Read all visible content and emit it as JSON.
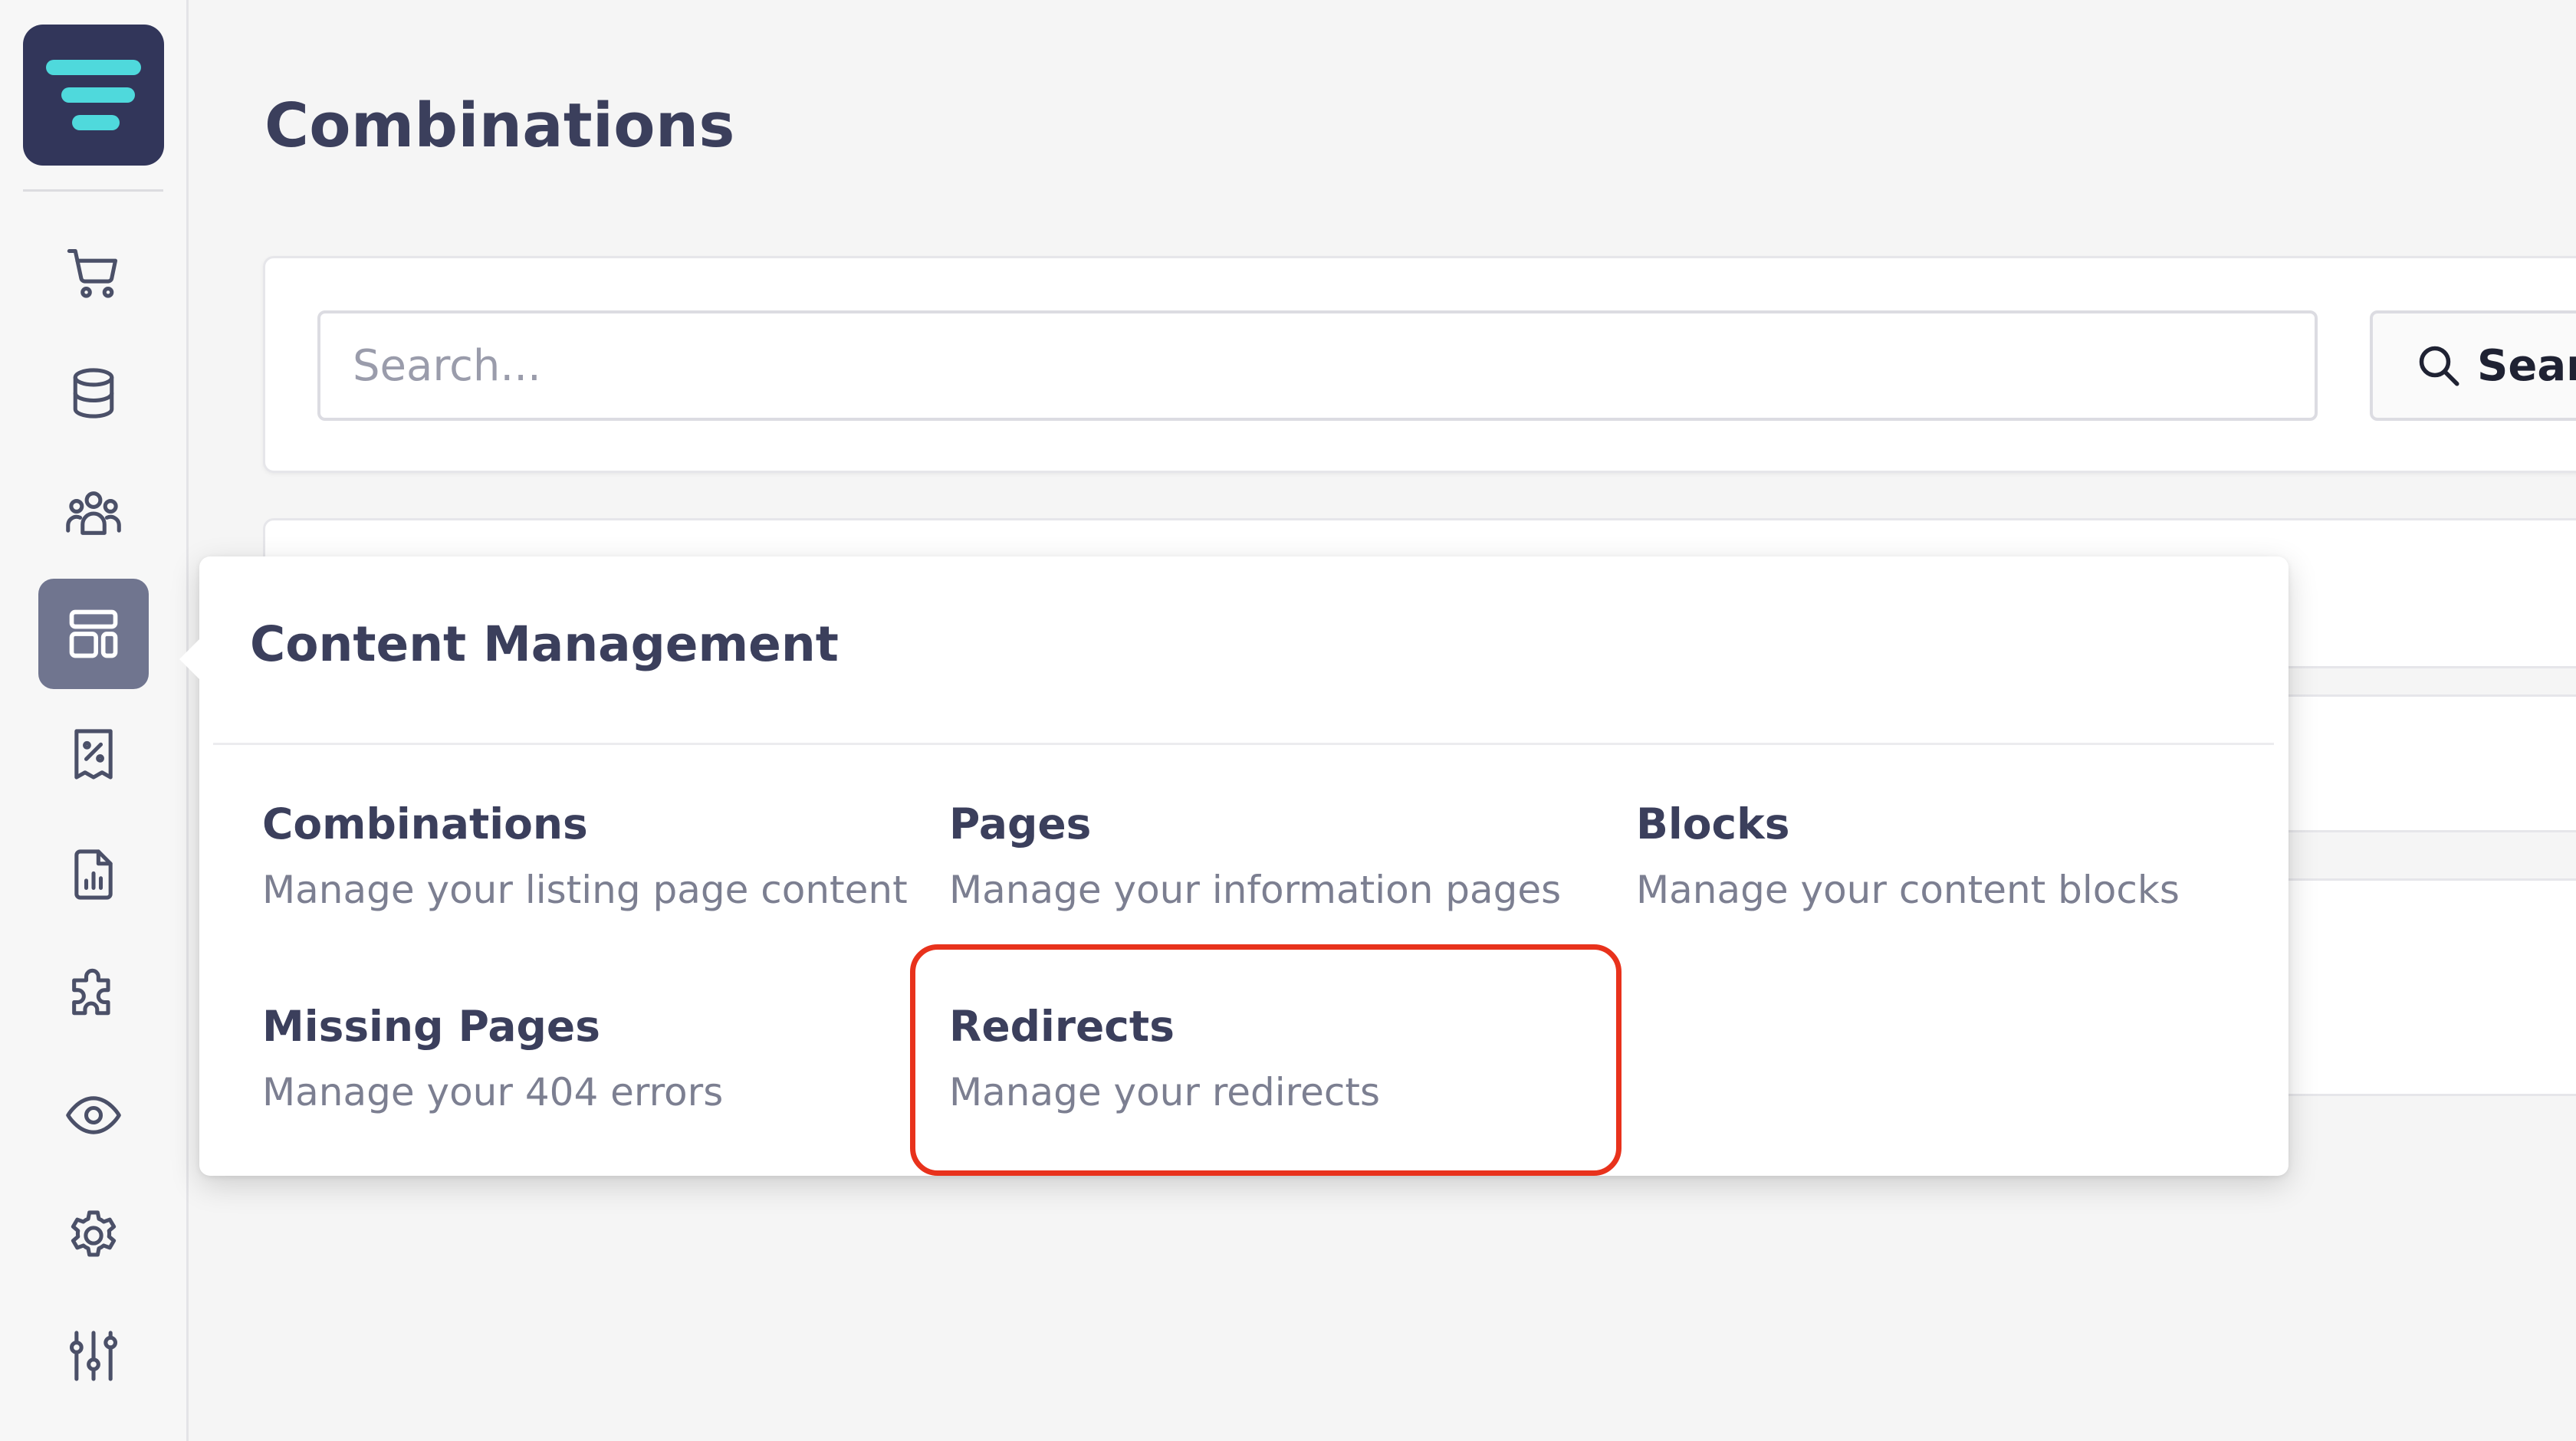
{
  "sidebar": {
    "logo_icon": "brand-logo-icon",
    "items": [
      {
        "icon": "cart-icon"
      },
      {
        "icon": "database-icon"
      },
      {
        "icon": "customers-icon"
      },
      {
        "icon": "layout-icon",
        "active": true
      },
      {
        "icon": "discount-receipt-icon"
      },
      {
        "icon": "report-icon"
      },
      {
        "icon": "puzzle-icon"
      },
      {
        "icon": "eye-icon"
      },
      {
        "icon": "gear-icon"
      },
      {
        "icon": "sliders-icon"
      }
    ]
  },
  "page": {
    "title": "Combinations"
  },
  "search": {
    "placeholder": "Search...",
    "button_label": "Search"
  },
  "popover": {
    "title": "Content Management",
    "items": [
      {
        "title": "Combinations",
        "description": "Manage your listing page content"
      },
      {
        "title": "Pages",
        "description": "Manage your information pages"
      },
      {
        "title": "Blocks",
        "description": "Manage your content blocks"
      },
      {
        "title": "Missing Pages",
        "description": "Manage your 404 errors"
      },
      {
        "title": "Redirects",
        "description": "Manage your redirects"
      }
    ]
  },
  "colors": {
    "brand_dark": "#32365a",
    "brand_teal": "#4fd9dc",
    "active_nav": "#70758f",
    "text_primary": "#3b3f5c",
    "text_secondary": "#7c7f91",
    "highlight": "#e8321c"
  }
}
